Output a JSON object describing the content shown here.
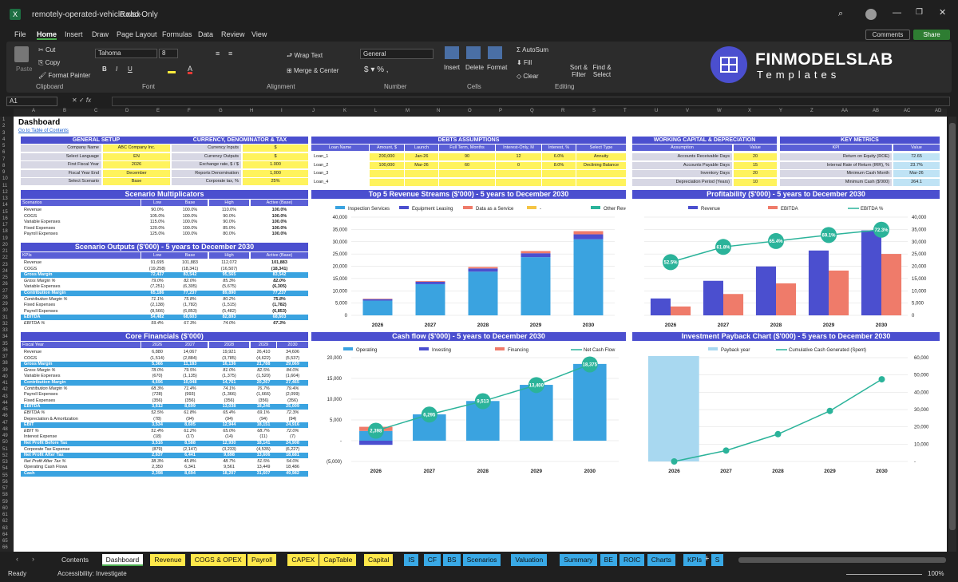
{
  "window": {
    "file": "remotely-operated-vehicle.xlsx",
    "mode": "Read-Only",
    "comments": "Comments",
    "share": "Share"
  },
  "menu": [
    "File",
    "Home",
    "Insert",
    "Draw",
    "Page Layout",
    "Formulas",
    "Data",
    "Review",
    "View"
  ],
  "ribbon": {
    "cut": "Cut",
    "copy": "Copy",
    "painter": "Format Painter",
    "paste": "Paste",
    "font": "Tahoma",
    "size": "8",
    "wrap": "Wrap Text",
    "merge": "Merge & Center",
    "numfmt": "General",
    "autosum": "AutoSum",
    "fill": "Fill",
    "clear": "Clear",
    "insert": "Insert",
    "delete": "Delete",
    "format": "Format",
    "sort": "Sort & Filter",
    "find": "Find & Select",
    "groups": [
      "Clipboard",
      "Font",
      "Alignment",
      "Number",
      "Cells",
      "Editing"
    ]
  },
  "logo": {
    "line1": "FINMODELSLAB",
    "line2": "Templates"
  },
  "namebox": "A1",
  "columns": [
    "A",
    "B",
    "C",
    "D",
    "E",
    "F",
    "G",
    "H",
    "I",
    "J",
    "K",
    "L",
    "M",
    "N",
    "O",
    "P",
    "Q",
    "R",
    "S",
    "T",
    "U",
    "V",
    "W",
    "X",
    "Y",
    "Z",
    "AA",
    "AB",
    "AC",
    "AD"
  ],
  "sheet": {
    "title": "Dashboard",
    "link": "Go to Table of Contents",
    "general": {
      "title": "GENERAL SETUP",
      "rows": [
        [
          "Company Name",
          "ABC Company Inc."
        ],
        [
          "Select Language",
          "EN"
        ],
        [
          "First Fiscal Year",
          "2026"
        ],
        [
          "Fiscal Year End",
          "December"
        ],
        [
          "Select Scenario",
          "Base"
        ]
      ]
    },
    "currency": {
      "title": "CURRENCY, DENOMINATOR & TAX",
      "rows": [
        [
          "Currency Inputs",
          "$"
        ],
        [
          "Currency Outputs",
          "$"
        ],
        [
          "Exchange rate, $ / $",
          "1.000"
        ],
        [
          "Reports Denomination",
          "1,000"
        ],
        [
          "Corporate tax, %",
          "25%"
        ]
      ]
    },
    "debts": {
      "title": "DEBTS ASSUMPTIONS",
      "headers": [
        "Loan Name",
        "Amount, $",
        "Launch",
        "Full Term, Months",
        "Interest-Only, M",
        "Interest, %",
        "Select Type"
      ],
      "rows": [
        [
          "Loan_1",
          "200,000",
          "Jan-26",
          "90",
          "12",
          "6.0%",
          "Annuity"
        ],
        [
          "Loan_2",
          "100,000",
          "Mar-26",
          "60",
          "0",
          "8.0%",
          "Declining Balance"
        ],
        [
          "Loan_3",
          "",
          "",
          "",
          "",
          "",
          ""
        ],
        [
          "Loan_4",
          "",
          "",
          "",
          "",
          "",
          ""
        ]
      ]
    },
    "wc": {
      "title": "WORKING CAPITAL & DEPRECIATION",
      "headers": [
        "Assumption",
        "Value"
      ],
      "rows": [
        [
          "Accounts Receivable Days",
          "20"
        ],
        [
          "Accounts Payable Days",
          "15"
        ],
        [
          "Inventory Days",
          "20"
        ],
        [
          "Depreciation Period (Years)",
          "10"
        ]
      ]
    },
    "kpi": {
      "title": "KEY METRICS",
      "headers": [
        "KPI",
        "Value"
      ],
      "rows": [
        [
          "Return on Equity (ROE)",
          "72.65"
        ],
        [
          "Internal Rate of Return (IRR), %",
          "23.7%"
        ],
        [
          "Minimum Cash Month",
          "Mar-26"
        ],
        [
          "Minimum Cash ($'000)",
          "264.1"
        ]
      ]
    },
    "multipliers": {
      "title": "Scenario Multiplicators",
      "headers": [
        "Scenarios",
        "Low",
        "Base",
        "High",
        "Active (Base)"
      ],
      "rows": [
        [
          "Revenue",
          "90.0%",
          "100.0%",
          "110.0%",
          "100.0%"
        ],
        [
          "COGS",
          "105.0%",
          "100.0%",
          "90.0%",
          "100.0%"
        ],
        [
          "Variable Expenses",
          "115.0%",
          "100.0%",
          "90.0%",
          "100.0%"
        ],
        [
          "Fixed Expenses",
          "120.0%",
          "100.0%",
          "85.0%",
          "100.0%"
        ],
        [
          "Payroll Expenses",
          "125.0%",
          "100.0%",
          "80.0%",
          "100.0%"
        ]
      ]
    },
    "outputs": {
      "title": "Scenario Outputs ($'000) - 5 years to December 2030",
      "headers": [
        "KPIs",
        "Low",
        "Base",
        "High",
        "Active (Base)"
      ],
      "rows": [
        [
          "Revenue",
          "91,695",
          "101,883",
          "112,072",
          "101,883"
        ],
        [
          "COGS",
          "(19,258)",
          "(18,341)",
          "(16,507)",
          "(18,341)"
        ],
        [
          "Gross Margin",
          "72,437",
          "83,542",
          "95,565",
          "83,542"
        ],
        [
          "Gross Margin %",
          "79.0%",
          "82.0%",
          "85.3%",
          "82.0%"
        ],
        [
          "Variable Expenses",
          "(7,251)",
          "(6,305)",
          "(5,675)",
          "(6,305)"
        ],
        [
          "Contribution Margin",
          "65,186",
          "77,237",
          "89,890",
          "77,237"
        ],
        [
          "Contribution Margin %",
          "71.1%",
          "75.8%",
          "80.2%",
          "75.8%"
        ],
        [
          "Fixed Expenses",
          "(2,138)",
          "(1,782)",
          "(1,515)",
          "(1,782)"
        ],
        [
          "Payroll Expenses",
          "(8,566)",
          "(6,853)",
          "(5,482)",
          "(6,853)"
        ],
        [
          "EBITDA",
          "54,482",
          "68,603",
          "82,893",
          "68,603"
        ],
        [
          "EBITDA %",
          "59.4%",
          "67.3%",
          "74.0%",
          "67.3%"
        ]
      ]
    },
    "core": {
      "title": "Core Financials ($'000)",
      "headers": [
        "Fiscal Year",
        "2026",
        "2027",
        "2028",
        "2029",
        "2030"
      ],
      "rows": [
        [
          "Revenue",
          "6,880",
          "14,067",
          "19,921",
          "26,410",
          "34,606"
        ],
        [
          "COGS",
          "(1,514)",
          "(2,884)",
          "(3,785)",
          "(4,622)",
          "(5,537)"
        ],
        [
          "Gross Margin",
          "5,366",
          "11,183",
          "16,136",
          "21,788",
          "29,069"
        ],
        [
          "Gross Margin %",
          "78.0%",
          "79.5%",
          "81.0%",
          "82.5%",
          "84.0%"
        ],
        [
          "Variable Expenses",
          "(670)",
          "(1,135)",
          "(1,375)",
          "(1,520)",
          "(1,604)"
        ],
        [
          "Contribution Margin",
          "4,696",
          "10,048",
          "14,761",
          "20,267",
          "27,465"
        ],
        [
          "Contribution Margin %",
          "68.3%",
          "71.4%",
          "74.1%",
          "76.7%",
          "79.4%"
        ],
        [
          "Payroll Expenses",
          "(728)",
          "(993)",
          "(1,366)",
          "(1,666)",
          "(2,099)"
        ],
        [
          "Fixed Expenses",
          "(356)",
          "(356)",
          "(356)",
          "(356)",
          "(356)"
        ],
        [
          "EBITDA",
          "3,612",
          "8,699",
          "13,038",
          "18,246",
          "25,009"
        ],
        [
          "EBITDA %",
          "52.5%",
          "61.8%",
          "65.4%",
          "69.1%",
          "72.3%"
        ],
        [
          "Depreciation & Amortization",
          "(78)",
          "(94)",
          "(94)",
          "(94)",
          "(94)"
        ],
        [
          "EBIT",
          "3,534",
          "8,605",
          "12,944",
          "18,151",
          "24,916"
        ],
        [
          "EBIT %",
          "51.4%",
          "61.2%",
          "65.0%",
          "68.7%",
          "72.0%"
        ],
        [
          "Interest Expense",
          "(18)",
          "(17)",
          "(14)",
          "(11)",
          "(7)"
        ],
        [
          "Net Profit Before Tax",
          "3,516",
          "8,588",
          "12,930",
          "18,141",
          "24,908"
        ],
        [
          "Corporate Tax Expense",
          "(879)",
          "(2,147)",
          "(3,233)",
          "(4,535)",
          "(6,227)"
        ],
        [
          "Net Profit After Tax",
          "2,637",
          "6,441",
          "9,698",
          "13,606",
          "18,681"
        ],
        [
          "Net Profit After Tax %",
          "38.3%",
          "45.8%",
          "48.7%",
          "51.5%",
          "54.0%"
        ],
        [
          "Operating Cash Flows",
          "2,350",
          "6,341",
          "9,561",
          "13,449",
          "18,486"
        ],
        [
          "Cash",
          "2,398",
          "8,694",
          "18,207",
          "31,607",
          "49,982"
        ]
      ]
    }
  },
  "chart_data": [
    {
      "type": "bar",
      "title": "Top 5 Revenue Streams ($'000) - 5 years to December 2030",
      "categories": [
        "2026",
        "2027",
        "2028",
        "2029",
        "2030"
      ],
      "ylim": [
        0,
        40000
      ],
      "series": [
        {
          "name": "Inspection Services",
          "values": [
            6000,
            12700,
            17800,
            23700,
            31000
          ],
          "color": "#3aa3e0"
        },
        {
          "name": "Equipment Leasing",
          "values": [
            600,
            1000,
            1300,
            1600,
            2000
          ],
          "color": "#4b4fcf"
        },
        {
          "name": "Data as a Service",
          "values": [
            200,
            300,
            600,
            900,
            1300
          ],
          "color": "#ef7b6a"
        },
        {
          "name": "-",
          "values": [
            0,
            0,
            0,
            0,
            0
          ],
          "color": "#f5c445"
        },
        {
          "name": "Other Revenue",
          "values": [
            0,
            0,
            0,
            0,
            0
          ],
          "color": "#2bb39a"
        }
      ]
    },
    {
      "type": "bar",
      "title": "Profitability ($'000) - 5 years to December 2030",
      "categories": [
        "2026",
        "2027",
        "2028",
        "2029",
        "2030"
      ],
      "ylim": [
        0,
        40000
      ],
      "series": [
        {
          "name": "Revenue",
          "values": [
            6880,
            14067,
            19921,
            26410,
            34606
          ],
          "color": "#4b4fcf"
        },
        {
          "name": "EBITDA",
          "values": [
            3612,
            8699,
            13038,
            18246,
            25009
          ],
          "color": "#ef7b6a"
        },
        {
          "name": "EBITDA %",
          "values": [
            52.5,
            61.8,
            65.4,
            69.1,
            72.3
          ],
          "color": "#2bb39a"
        }
      ]
    },
    {
      "type": "bar",
      "title": "Cash flow ($'000) - 5 years to December 2030",
      "categories": [
        "2026",
        "2027",
        "2028",
        "2029",
        "2030"
      ],
      "ylim": [
        -5000,
        20000
      ],
      "series": [
        {
          "name": "Operating",
          "values": [
            2350,
            6341,
            9561,
            13449,
            18486
          ],
          "color": "#3aa3e0"
        },
        {
          "name": "Investing",
          "values": [
            -1000,
            0,
            0,
            0,
            0
          ],
          "color": "#4b4fcf"
        },
        {
          "name": "Financing",
          "values": [
            1000,
            0,
            0,
            0,
            0
          ],
          "color": "#ef7b6a"
        },
        {
          "name": "Net Cash Flow",
          "values": [
            2398,
            6295,
            9513,
            13400,
            18375
          ],
          "color": "#2bb39a"
        }
      ]
    },
    {
      "type": "line",
      "title": "Investment Payback Chart ($'000) - 5 years to December 2030",
      "categories": [
        "2026",
        "2027",
        "2028",
        "2029",
        "2030"
      ],
      "ylim": [
        0,
        60000
      ],
      "series": [
        {
          "name": "Payback year",
          "values": [
            1,
            0,
            0,
            0,
            0
          ],
          "color": "#a8d8f0"
        },
        {
          "name": "Cumulative Cash Generated (Spent)",
          "values": [
            0,
            6300,
            15800,
            29200,
            47500
          ],
          "color": "#2bb39a"
        }
      ]
    }
  ],
  "tabs": [
    "Contents",
    "Dashboard",
    "Revenue",
    "COGS & OPEX",
    "Payroll",
    "CAPEX",
    "CapTable",
    "Capital",
    "IS",
    "CF",
    "BS",
    "Scenarios",
    "Valuation",
    "Summary",
    "BE",
    "ROIC",
    "Charts",
    "KPIs",
    "S"
  ],
  "status": {
    "ready": "Ready",
    "access": "Accessibility: Investigate",
    "zoom": "100%"
  }
}
